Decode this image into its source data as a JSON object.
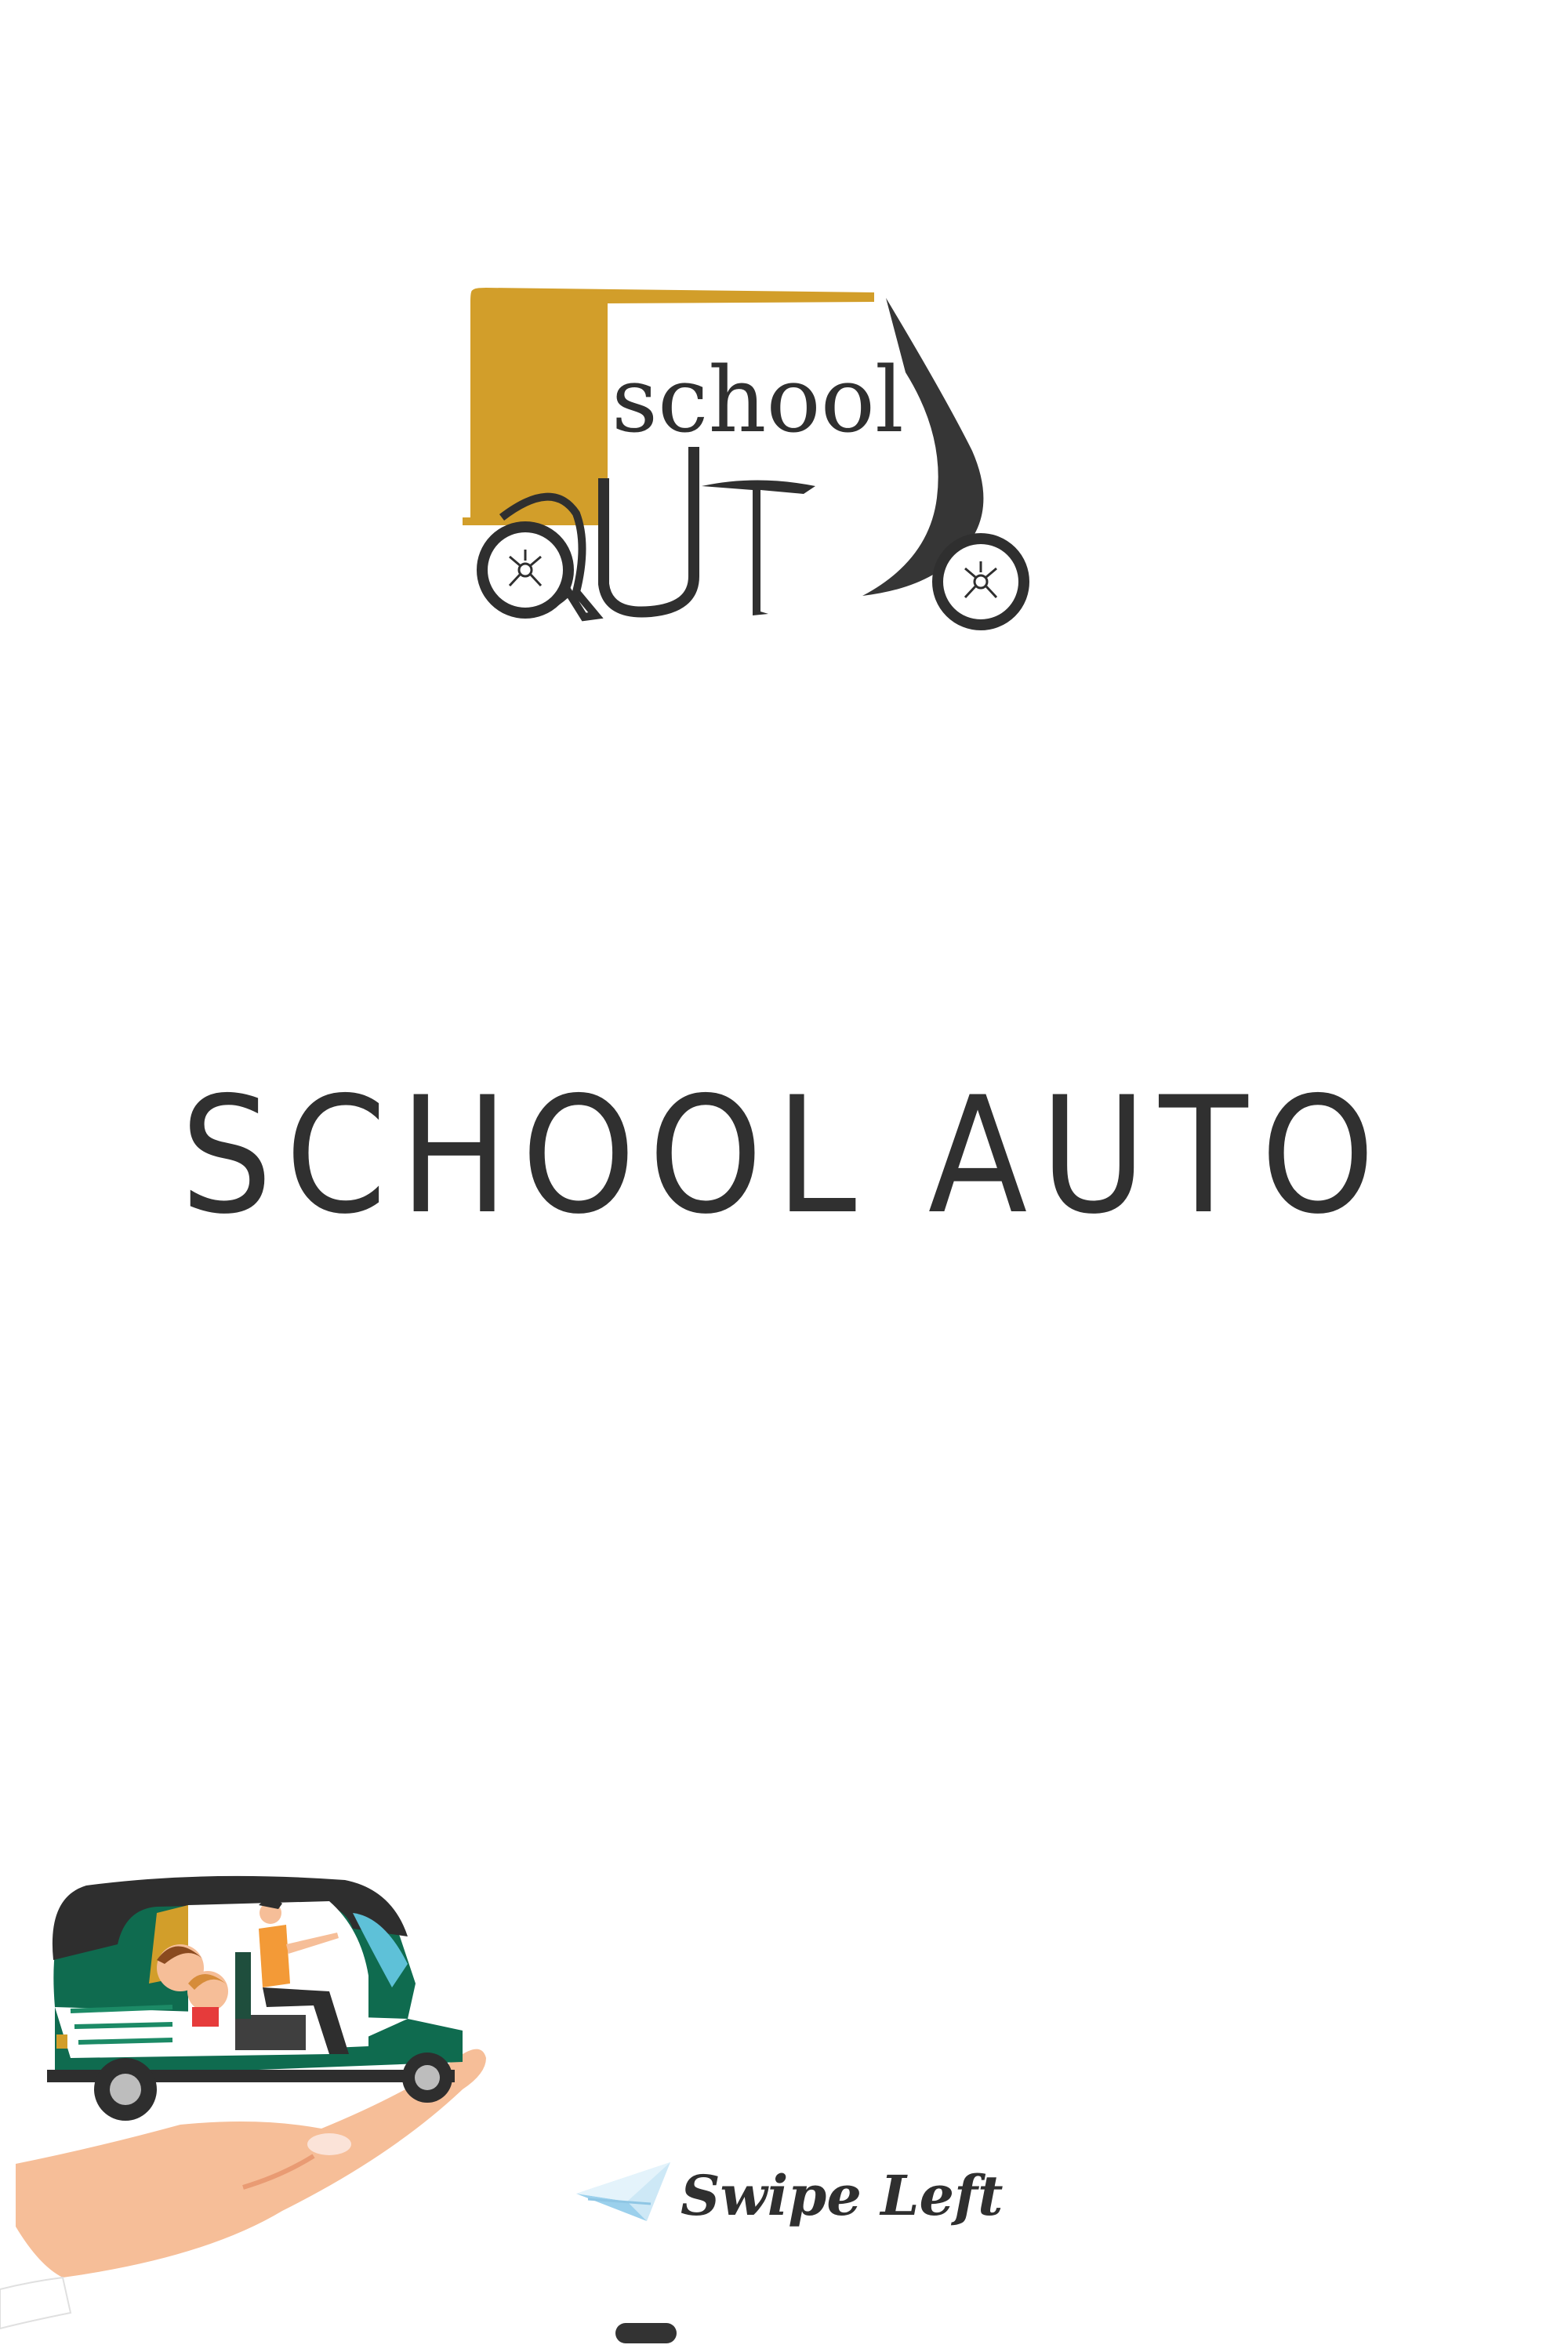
{
  "logo": {
    "word_top": "school",
    "word_bottom": "auto",
    "icon": "auto-rickshaw-logo-icon"
  },
  "brand": {
    "title": "SCHOOL AUTO"
  },
  "illustration": {
    "icon": "hand-holding-auto-rickshaw-illustration"
  },
  "swipe": {
    "label": "Swipe Left",
    "icon": "paper-plane-icon"
  },
  "colors": {
    "accent": "#D29E2A",
    "dark": "#333333",
    "green": "#0F6B4F",
    "skin": "#F6BE98",
    "background": "#FFFFFF"
  }
}
